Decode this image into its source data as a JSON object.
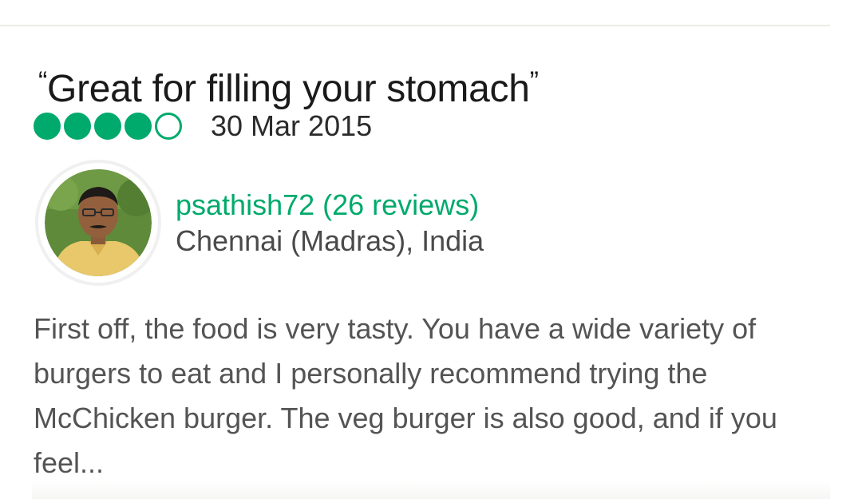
{
  "review": {
    "title_open_quote": "“",
    "title": "Great for filling your stomach",
    "title_close_quote": "”",
    "rating": 4,
    "rating_max": 5,
    "date": "30 Mar 2015",
    "body": "First off, the food is very tasty. You have a wide variety of burgers to eat and I personally recommend trying the McChicken burger. The veg burger is also good, and if you feel..."
  },
  "reviewer": {
    "name_label": "psathish72 (26 reviews)",
    "location": "Chennai (Madras), India"
  },
  "colors": {
    "accent": "#00aa6c",
    "title_text": "#1a1a1a",
    "body_text": "#545454"
  },
  "icons": {
    "filled_bubble": "rating-bubble-filled-icon",
    "empty_bubble": "rating-bubble-empty-icon"
  }
}
